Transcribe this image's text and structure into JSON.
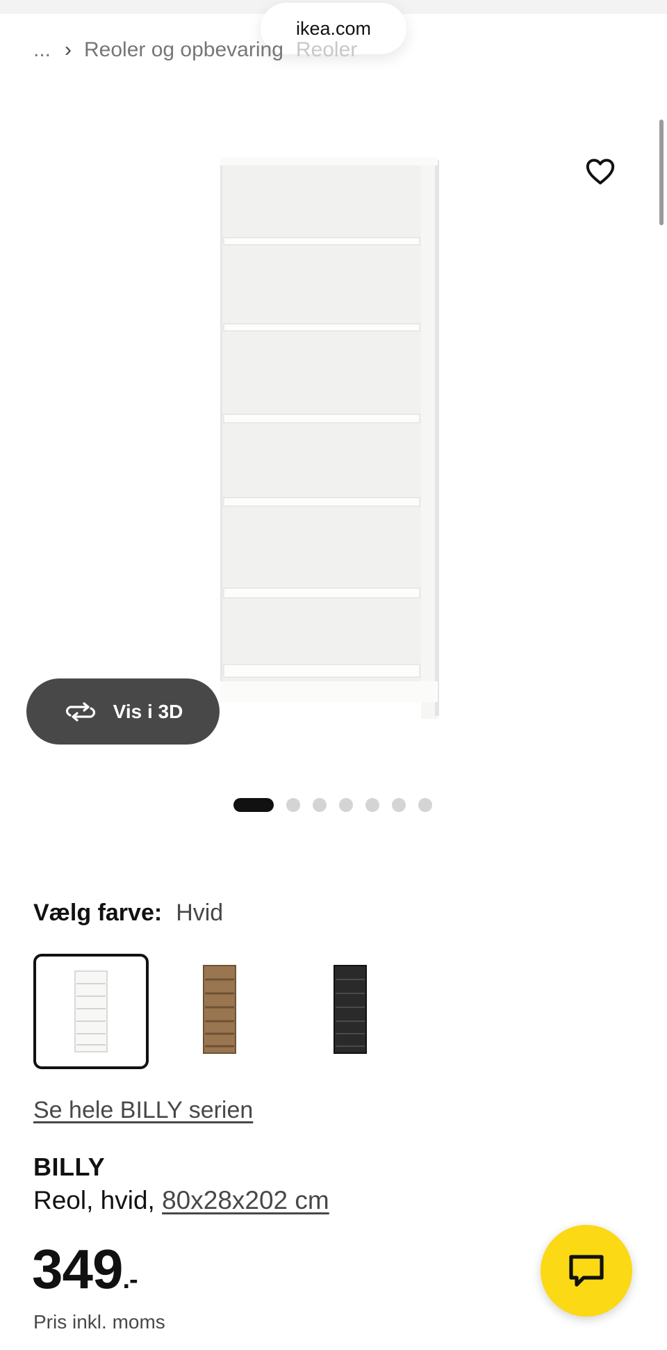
{
  "browser": {
    "url": "ikea.com"
  },
  "breadcrumb": {
    "ellipsis": "...",
    "category": "Reoler og opbevaring",
    "current": "Reoler"
  },
  "gallery": {
    "view3d_label": "Vis i 3D",
    "dots_total": 7,
    "active_dot": 1
  },
  "color_picker": {
    "label": "Vælg farve:",
    "selected": "Hvid",
    "options": [
      {
        "name": "Hvid",
        "color": "#f4f4f2",
        "selected": true
      },
      {
        "name": "Brun",
        "color": "#8b6a4a",
        "selected": false
      },
      {
        "name": "Sort",
        "color": "#2a2a2a",
        "selected": false
      }
    ]
  },
  "series_link": "Se hele BILLY serien",
  "product": {
    "name": "BILLY",
    "description": "Reol, hvid, ",
    "dimensions": "80x28x202 cm",
    "price": "349",
    "price_suffix": ".-",
    "price_note": "Pris inkl. moms"
  },
  "colors": {
    "chat_button": "#fbd914",
    "dark": "#111111",
    "pill": "#484848"
  },
  "icons": {
    "favorite": "heart-icon",
    "rotate": "rotate-3d-icon",
    "chat": "chat-icon"
  }
}
